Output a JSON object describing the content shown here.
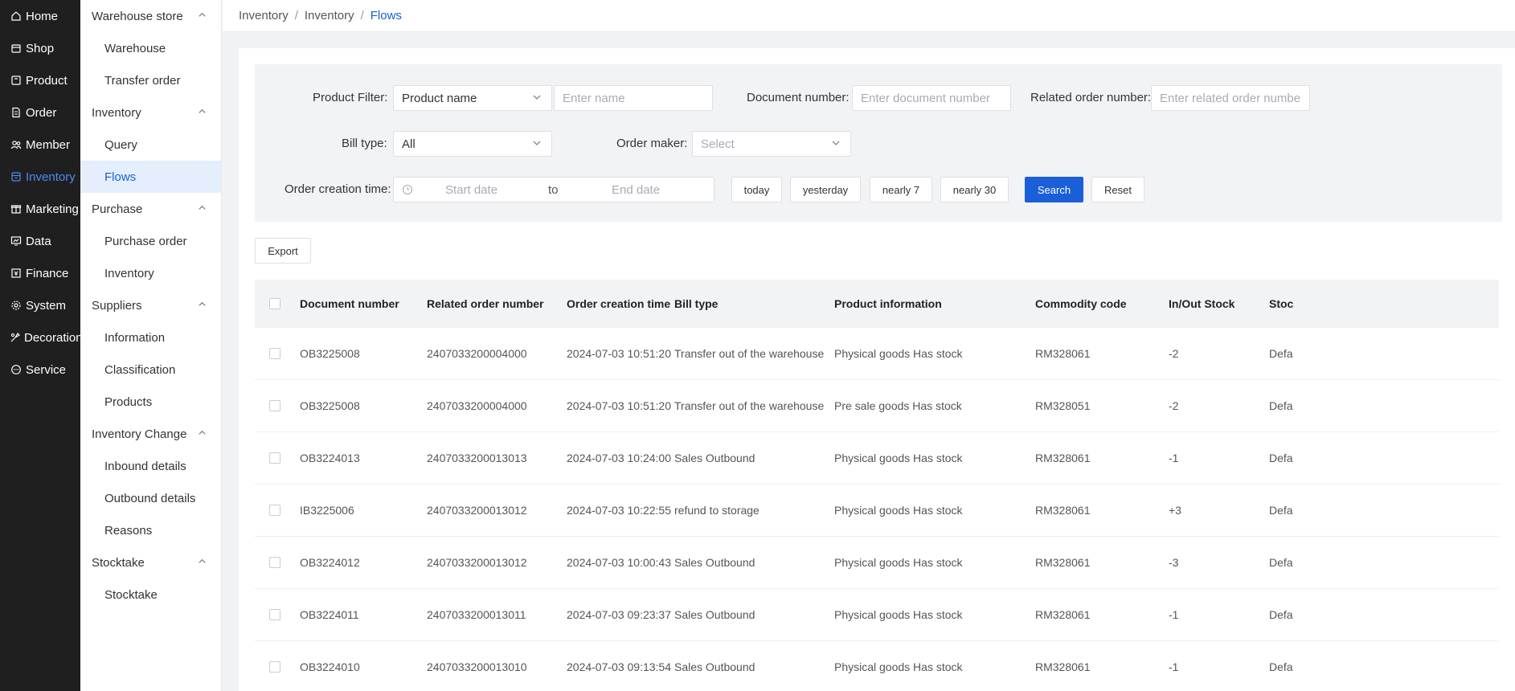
{
  "primary_nav": [
    {
      "label": "Home",
      "icon": "home-icon"
    },
    {
      "label": "Shop",
      "icon": "shop-icon"
    },
    {
      "label": "Product",
      "icon": "product-icon"
    },
    {
      "label": "Order",
      "icon": "order-icon"
    },
    {
      "label": "Member",
      "icon": "member-icon"
    },
    {
      "label": "Inventory",
      "icon": "inventory-icon"
    },
    {
      "label": "Marketing",
      "icon": "marketing-icon"
    },
    {
      "label": "Data",
      "icon": "data-icon"
    },
    {
      "label": "Finance",
      "icon": "finance-icon"
    },
    {
      "label": "System",
      "icon": "system-icon"
    },
    {
      "label": "Decoration",
      "icon": "decoration-icon"
    },
    {
      "label": "Service",
      "icon": "service-icon"
    }
  ],
  "secondary_nav": {
    "groups": [
      {
        "label": "Warehouse store",
        "items": [
          "Warehouse",
          "Transfer order"
        ]
      },
      {
        "label": "Inventory",
        "items": [
          "Query",
          "Flows"
        ]
      },
      {
        "label": "Purchase",
        "items": [
          "Purchase order",
          "Inventory"
        ]
      },
      {
        "label": "Suppliers",
        "items": [
          "Information",
          "Classification",
          "Products"
        ]
      },
      {
        "label": "Inventory Change",
        "items": [
          "Inbound details",
          "Outbound details",
          "Reasons"
        ]
      },
      {
        "label": "Stocktake",
        "items": [
          "Stocktake"
        ]
      }
    ],
    "active_item": "Flows"
  },
  "breadcrumb": [
    "Inventory",
    "Inventory",
    "Flows"
  ],
  "filters": {
    "product_filter_label": "Product Filter:",
    "product_filter_value": "Product name",
    "product_name_placeholder": "Enter name",
    "document_number_label": "Document number:",
    "document_number_placeholder": "Enter document number",
    "related_order_label": "Related order number:",
    "related_order_placeholder": "Enter related order numbe",
    "bill_type_label": "Bill type:",
    "bill_type_value": "All",
    "order_maker_label": "Order maker:",
    "order_maker_placeholder": "Select",
    "creation_time_label": "Order creation time:",
    "start_date_placeholder": "Start date",
    "date_separator": "to",
    "end_date_placeholder": "End date",
    "quick_dates": [
      "today",
      "yesterday",
      "nearly 7",
      "nearly 30"
    ],
    "search_label": "Search",
    "reset_label": "Reset"
  },
  "export_label": "Export",
  "table": {
    "columns": [
      "Document number",
      "Related order number",
      "Order creation time",
      "Bill type",
      "Product information",
      "Commodity code",
      "In/Out Stock",
      "Stoc"
    ],
    "rows": [
      [
        "OB3225008",
        "2407033200004000",
        "2024-07-03 10:51:20",
        "Transfer out of the warehouse",
        "Physical goods Has stock",
        "RM328061",
        "-2",
        "Defa"
      ],
      [
        "OB3225008",
        "2407033200004000",
        "2024-07-03 10:51:20",
        "Transfer out of the warehouse",
        "Pre sale goods Has stock",
        "RM328051",
        "-2",
        "Defa"
      ],
      [
        "OB3224013",
        "2407033200013013",
        "2024-07-03 10:24:00",
        "Sales Outbound",
        "Physical goods Has stock",
        "RM328061",
        "-1",
        "Defa"
      ],
      [
        "IB3225006",
        "2407033200013012",
        "2024-07-03 10:22:55",
        "refund to storage",
        "Physical goods Has stock",
        "RM328061",
        "+3",
        "Defa"
      ],
      [
        "OB3224012",
        "2407033200013012",
        "2024-07-03 10:00:43",
        "Sales Outbound",
        "Physical goods Has stock",
        "RM328061",
        "-3",
        "Defa"
      ],
      [
        "OB3224011",
        "2407033200013011",
        "2024-07-03 09:23:37",
        "Sales Outbound",
        "Physical goods Has stock",
        "RM328061",
        "-1",
        "Defa"
      ],
      [
        "OB3224010",
        "2407033200013010",
        "2024-07-03 09:13:54",
        "Sales Outbound",
        "Physical goods Has stock",
        "RM328061",
        "-1",
        "Defa"
      ]
    ]
  },
  "colors": {
    "accent": "#1a5fd8",
    "nav_bg": "#1f1f1f",
    "active_bg": "#e5eefc"
  }
}
